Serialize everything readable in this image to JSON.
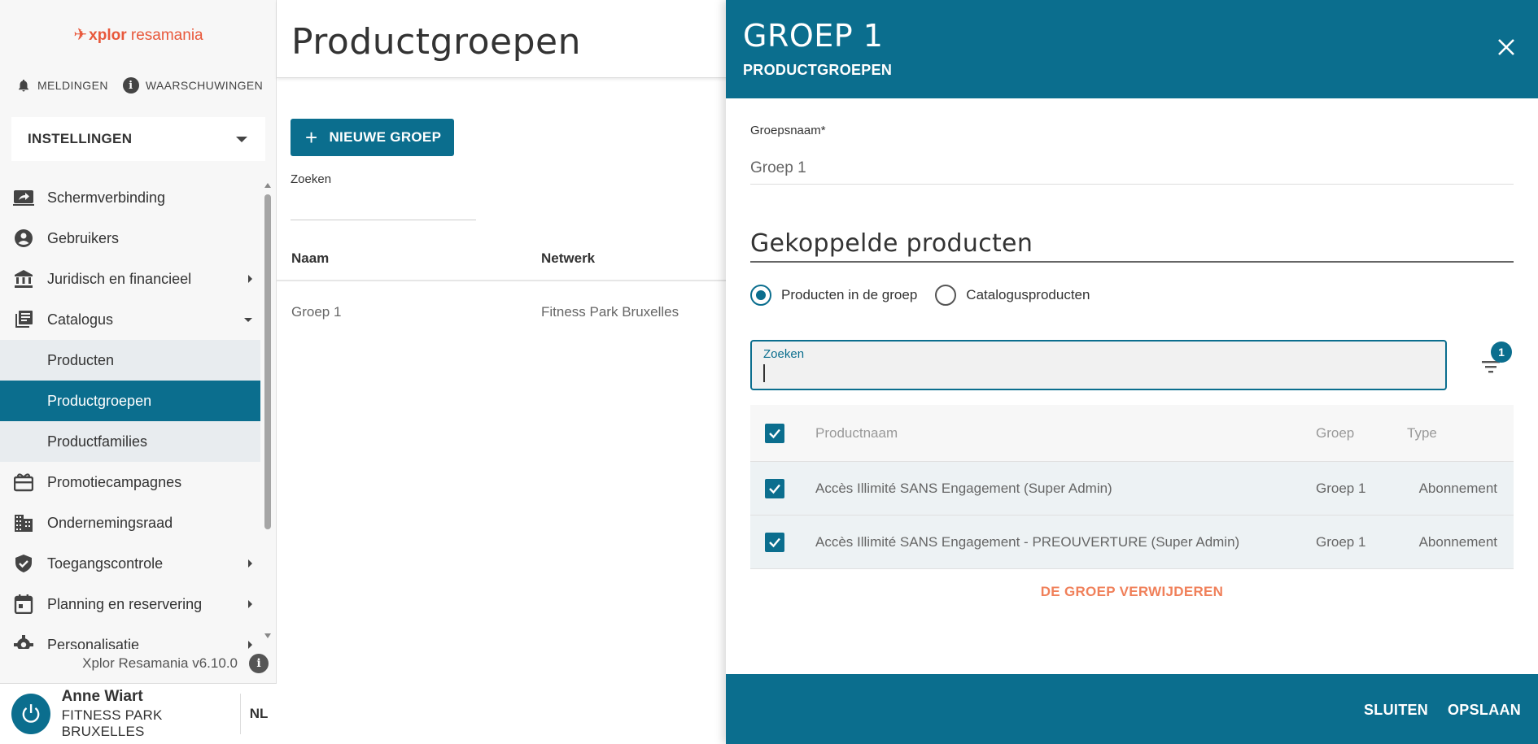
{
  "sidebar": {
    "logo": {
      "brand": "xplor",
      "name": "resamania"
    },
    "alerts": {
      "notifications": "MELDINGEN",
      "warnings": "WAARSCHUWINGEN"
    },
    "section_select": "INSTELLINGEN",
    "items": [
      {
        "label": "Schermverbinding",
        "icon": "screen-share-icon"
      },
      {
        "label": "Gebruikers",
        "icon": "account-circle-icon"
      },
      {
        "label": "Juridisch en financieel",
        "icon": "bank-icon",
        "expandable": true
      },
      {
        "label": "Catalogus",
        "icon": "library-books-icon",
        "expanded": true
      },
      {
        "label": "Producten",
        "sub": true
      },
      {
        "label": "Productgroepen",
        "sub": true,
        "active": true
      },
      {
        "label": "Productfamilies",
        "sub": true
      },
      {
        "label": "Promotiecampagnes",
        "icon": "card-giftcard-icon"
      },
      {
        "label": "Ondernemingsraad",
        "icon": "domain-icon"
      },
      {
        "label": "Toegangscontrole",
        "icon": "verified-shield-icon",
        "expandable": true
      },
      {
        "label": "Planning en reservering",
        "icon": "calendar-icon",
        "expandable": true
      },
      {
        "label": "Personalisatie",
        "icon": "gear-icon",
        "expandable": true
      }
    ],
    "version": "Xplor Resamania v6.10.0",
    "user": {
      "name": "Anne Wiart",
      "club": "FITNESS PARK BRUXELLES",
      "lang": "NL"
    }
  },
  "main": {
    "title": "Productgroepen",
    "new_group_label": "NIEUWE GROEP",
    "search_label": "Zoeken",
    "columns": [
      "Naam",
      "Netwerk"
    ],
    "rows": [
      {
        "name": "Groep 1",
        "network": "Fitness Park Bruxelles"
      }
    ]
  },
  "drawer": {
    "title": "GROEP 1",
    "subtitle": "PRODUCTGROEPEN",
    "name_label": "Groepsnaam*",
    "name_value": "Groep 1",
    "section_title": "Gekoppelde producten",
    "radio_in_group": "Producten in de groep",
    "radio_catalog": "Catalogusproducten",
    "search_label": "Zoeken",
    "filter_count": "1",
    "table": {
      "headers": {
        "name": "Productnaam",
        "group": "Groep",
        "type": "Type"
      },
      "rows": [
        {
          "name": "Accès Illimité SANS Engagement (Super Admin)",
          "group": "Groep 1",
          "type": "Abonnement"
        },
        {
          "name": "Accès Illimité SANS Engagement - PREOUVERTURE (Super Admin)",
          "group": "Groep 1",
          "type": "Abonnement"
        }
      ]
    },
    "delete_label": "DE GROEP VERWIJDEREN",
    "close_label": "SLUITEN",
    "save_label": "OPSLAAN"
  },
  "colors": {
    "primary": "#0b6e8e",
    "danger": "#f0805a",
    "brand": "#e8583b"
  }
}
